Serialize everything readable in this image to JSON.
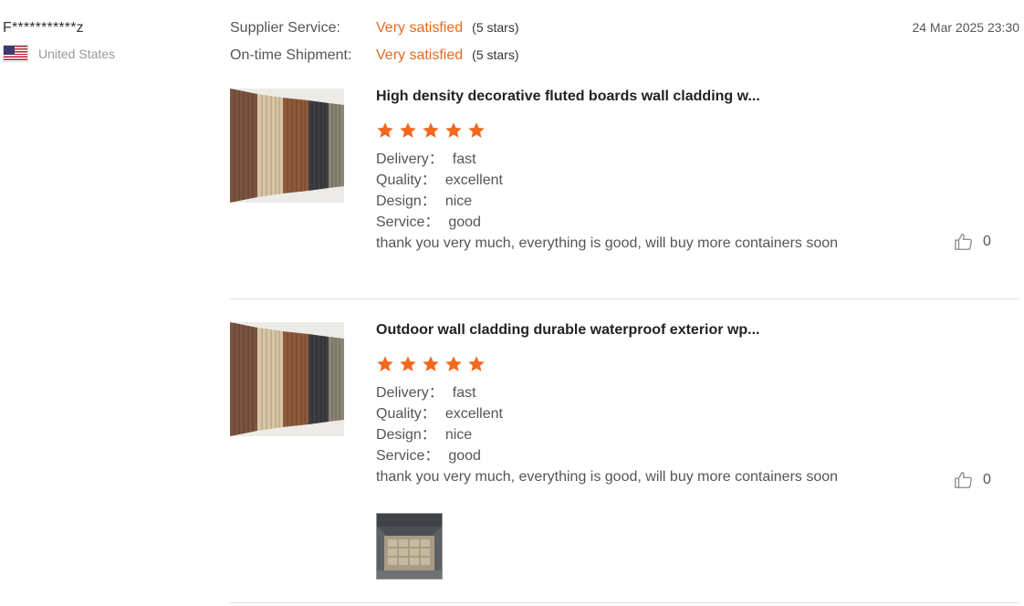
{
  "reviewer": {
    "name": "F***********z",
    "country": "United States",
    "flag_icon": "us-flag-icon"
  },
  "supplier_service": {
    "label": "Supplier Service:",
    "value": "Very satisfied",
    "count": "(5 stars)"
  },
  "ontime_shipment": {
    "label": "On-time Shipment:",
    "value": "Very satisfied",
    "count": "(5 stars)"
  },
  "date": "24 Mar 2025 23:30",
  "colors": {
    "accent": "#e56a1f",
    "star": "#f2691e",
    "divider": "#e0e0e0"
  },
  "reviews": [
    {
      "title": "High density decorative fluted boards wall cladding w...",
      "rating": 5,
      "delivery_label": "Delivery：",
      "delivery": "fast",
      "quality_label": "Quality：",
      "quality": "excellent",
      "design_label": "Design：",
      "design": "nice",
      "service_label": "Service：",
      "service": "good",
      "comment": "thank you very much, everything is good, will buy more containers soon",
      "likes": "0"
    },
    {
      "title": "Outdoor wall cladding durable waterproof exterior wp...",
      "rating": 5,
      "delivery_label": "Delivery：",
      "delivery": "fast",
      "quality_label": "Quality：",
      "quality": "excellent",
      "design_label": "Design：",
      "design": "nice",
      "service_label": "Service：",
      "service": "good",
      "comment": "thank you very much, everything is good, will buy more containers soon",
      "likes": "0"
    }
  ]
}
